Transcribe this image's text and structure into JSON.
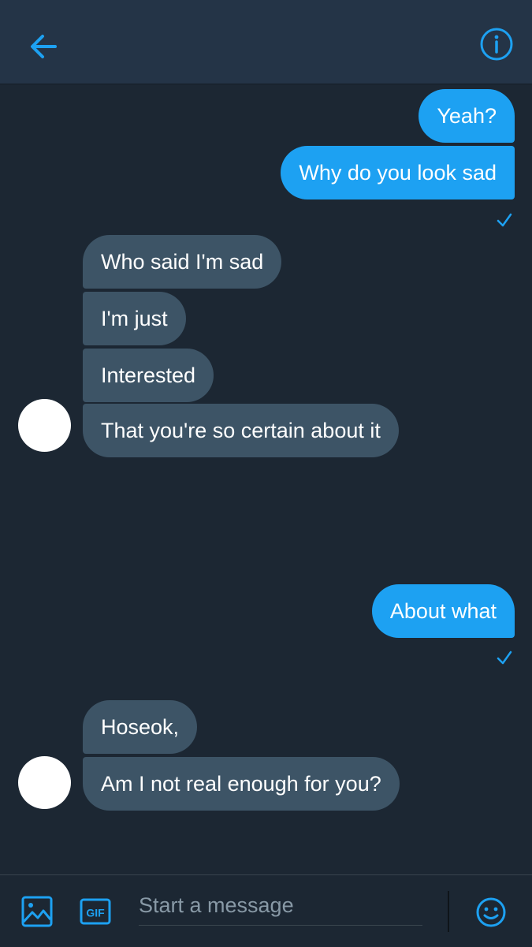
{
  "header": {
    "back_icon": "arrow-left-icon",
    "info_icon": "info-circle-icon",
    "accent_color": "#1da1f2"
  },
  "messages": [
    {
      "direction": "outgoing",
      "text": "Yeah?"
    },
    {
      "direction": "outgoing",
      "text": "Why do you look sad",
      "status": "sent"
    },
    {
      "direction": "incoming",
      "text": "Who said I'm sad"
    },
    {
      "direction": "incoming",
      "text": "I'm just"
    },
    {
      "direction": "incoming",
      "text": "Interested"
    },
    {
      "direction": "incoming",
      "text": "That you're so certain about it"
    },
    {
      "direction": "outgoing",
      "text": "About what",
      "status": "sent"
    },
    {
      "direction": "incoming",
      "text": "Hoseok,"
    },
    {
      "direction": "incoming",
      "text": "Am I not real enough for you?"
    }
  ],
  "composer": {
    "placeholder": "Start a message",
    "image_icon": "image-icon",
    "gif_label": "GIF",
    "emoji_icon": "emoji-icon"
  },
  "colors": {
    "background": "#1c2733",
    "header": "#243447",
    "outgoing_bubble": "#1da1f2",
    "incoming_bubble": "#3d5466"
  }
}
